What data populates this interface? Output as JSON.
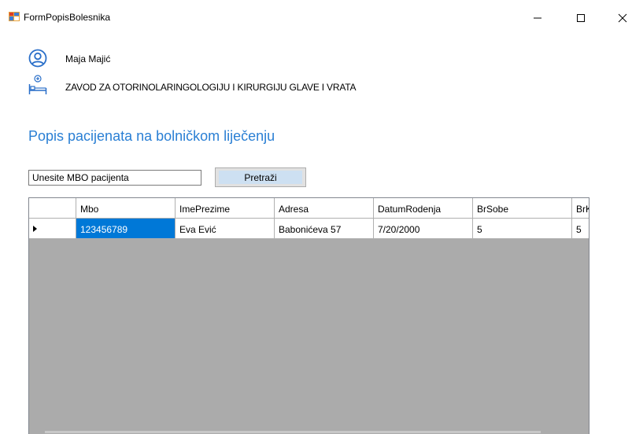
{
  "window": {
    "title": "FormPopisBolesnika",
    "minimize_label": "—",
    "maximize_label": "☐",
    "close_label": "✕"
  },
  "header": {
    "user_name": "Maja Majić",
    "department": "ZAVOD ZA OTORINOLARINGOLOGIJU I KIRURGIJU GLAVE I VRATA"
  },
  "page": {
    "title": "Popis pacijenata na bolničkom liječenju"
  },
  "search": {
    "value": "Unesite MBO pacijenta",
    "button_label": "Pretraži"
  },
  "table": {
    "columns": [
      "Mbo",
      "ImePrezime",
      "Adresa",
      "DatumRodenja",
      "BrSobe",
      "BrKre"
    ],
    "rows": [
      [
        "123456789",
        "Eva Ević",
        "Babonićeva 57",
        "7/20/2000",
        "5",
        "5"
      ]
    ]
  },
  "colors": {
    "accent": "#2a7fd4",
    "selection": "#0078d7",
    "grid_background": "#ababab"
  },
  "icons": {
    "app": "form-icon",
    "user": "user-circle-icon",
    "hospital": "hospital-bed-icon"
  }
}
